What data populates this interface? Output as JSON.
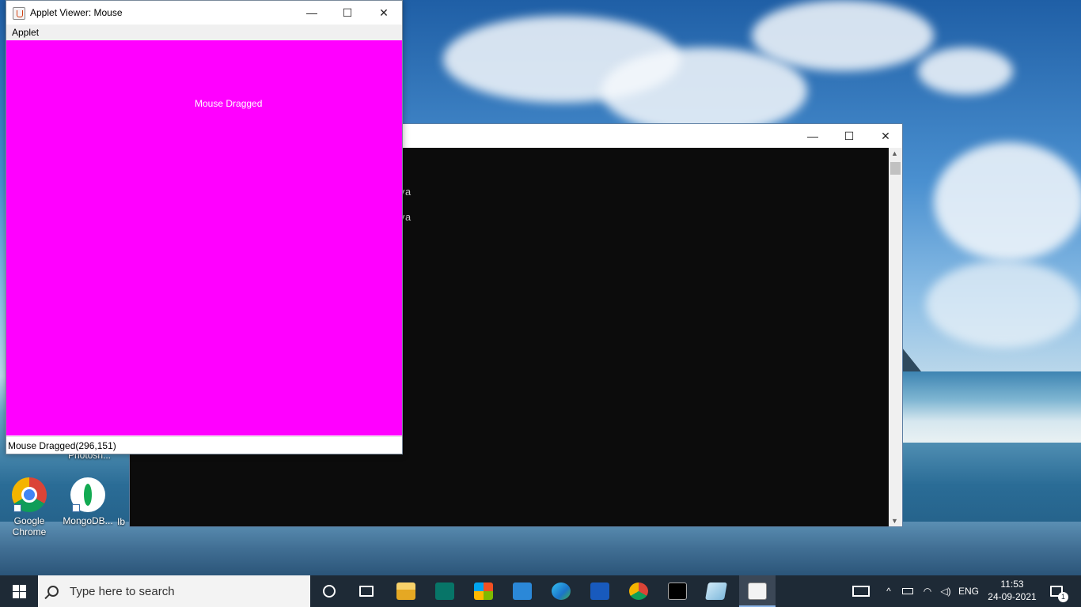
{
  "desktop": {
    "icons": [
      {
        "label": "Google Chrome",
        "label_line1": "Google",
        "label_line2": "Chrome",
        "icon": "chrome-icon"
      },
      {
        "label": "MongoDB...",
        "icon": "mongodb-compass-icon"
      }
    ],
    "partial_label_photoshop": "Photosh...",
    "partial_label_third": "Ib"
  },
  "console_window": {
    "lines": [
      "va",
      "va"
    ],
    "controls": {
      "minimize": "—",
      "maximize": "☐",
      "close": "✕"
    }
  },
  "applet_window": {
    "title": "Applet Viewer: Mouse",
    "menu": [
      "Applet"
    ],
    "canvas_text": "Mouse Dragged",
    "canvas_color": "#ff00ff",
    "status_text": "Mouse Dragged(296,151)",
    "controls": {
      "minimize": "—",
      "maximize": "☐",
      "close": "✕"
    }
  },
  "taskbar": {
    "search_placeholder": "Type here to search",
    "pinned_apps": [
      "cortana-icon",
      "task-view-icon",
      "file-explorer-icon",
      "publisher-icon",
      "microsoft-store-icon",
      "mail-icon",
      "edge-icon",
      "word-icon",
      "chrome-icon",
      "command-prompt-icon",
      "notepad-icon",
      "java-icon"
    ],
    "tray": {
      "language": "ENG",
      "time": "11:53",
      "date": "24-09-2021",
      "notification_count": "1"
    }
  }
}
